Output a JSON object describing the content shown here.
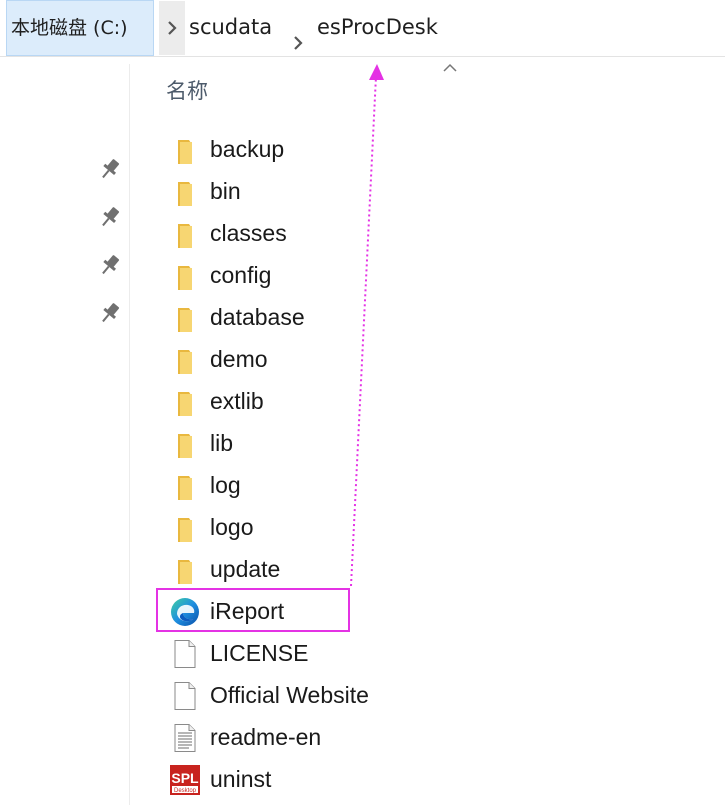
{
  "breadcrumb": {
    "items": [
      "本地磁盘 (C:)",
      "scudata",
      "esProcDesk"
    ]
  },
  "quick_access": {
    "pins": [
      "pin-icon",
      "pin-icon",
      "pin-icon",
      "pin-icon"
    ]
  },
  "file_list": {
    "column_name_header": "名称",
    "sort_indicator": "chevron-up-icon",
    "items": [
      {
        "name": "backup",
        "type": "folder"
      },
      {
        "name": "bin",
        "type": "folder"
      },
      {
        "name": "classes",
        "type": "folder"
      },
      {
        "name": "config",
        "type": "folder"
      },
      {
        "name": "database",
        "type": "folder"
      },
      {
        "name": "demo",
        "type": "folder"
      },
      {
        "name": "extlib",
        "type": "folder"
      },
      {
        "name": "lib",
        "type": "folder"
      },
      {
        "name": "log",
        "type": "folder"
      },
      {
        "name": "logo",
        "type": "folder"
      },
      {
        "name": "update",
        "type": "folder"
      },
      {
        "name": "iReport",
        "type": "edge-shortcut"
      },
      {
        "name": "LICENSE",
        "type": "file"
      },
      {
        "name": "Official Website",
        "type": "file"
      },
      {
        "name": "readme-en",
        "type": "text-file"
      },
      {
        "name": "uninst",
        "type": "spl-app"
      }
    ],
    "highlighted_item": "iReport"
  },
  "colors": {
    "folder": "#f5cf5a",
    "highlight": "#e432e4",
    "breadcrumb_selected": "#dcecfb"
  },
  "app_icon_text": {
    "line1": "SPL",
    "line2": "Desktop"
  }
}
